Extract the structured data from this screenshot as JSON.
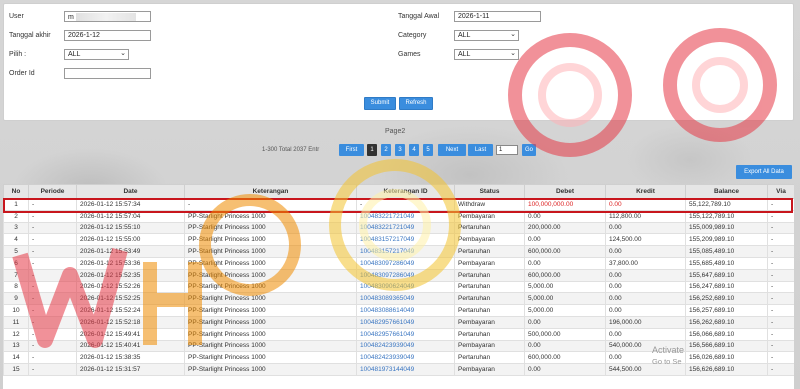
{
  "filters": {
    "user_label": "User",
    "user_value": "m",
    "tanggal_akhir_label": "Tanggal akhir",
    "tanggal_akhir_value": "2026-1-12",
    "pilih_label": "Pilih :",
    "pilih_value": "ALL",
    "order_id_label": "Order Id",
    "order_id_value": "",
    "tanggal_awal_label": "Tanggal Awal",
    "tanggal_awal_value": "2026-1-11",
    "category_label": "Category",
    "category_value": "ALL",
    "games_label": "Games",
    "games_value": "ALL",
    "submit_label": "Submit",
    "refresh_label": "Refresh"
  },
  "pager": {
    "title": "Page2",
    "entries": "1-300 Total 2037 Entr",
    "first": "First",
    "pages": [
      "1",
      "2",
      "3",
      "4",
      "5"
    ],
    "active_page": "1",
    "next": "Next",
    "last": "Last",
    "page_input": "1",
    "go": "Go"
  },
  "export_label": "Export All Data",
  "table": {
    "headers": [
      "No",
      "Periode",
      "Date",
      "Keterangan",
      "Keterangan ID",
      "Status",
      "Debet",
      "Kredit",
      "Balance",
      "Via"
    ],
    "rows": [
      [
        "1",
        "-",
        "2026-01-12 15:57:34",
        "-",
        "-",
        "Withdraw",
        "100,000,000.00",
        "0.00",
        "55,122,789.10",
        "-"
      ],
      [
        "2",
        "-",
        "2026-01-12 15:57:04",
        "PP-Starlight Princess 1000",
        "100483221721049",
        "Pembayaran",
        "0.00",
        "112,800.00",
        "155,122,789.10",
        "-"
      ],
      [
        "3",
        "-",
        "2026-01-12 15:55:10",
        "PP-Starlight Princess 1000",
        "100483221721049",
        "Pertaruhan",
        "200,000.00",
        "0.00",
        "155,009,989.10",
        "-"
      ],
      [
        "4",
        "-",
        "2026-01-12 15:55:00",
        "PP-Starlight Princess 1000",
        "100483157217049",
        "Pembayaran",
        "0.00",
        "124,500.00",
        "155,209,989.10",
        "-"
      ],
      [
        "5",
        "-",
        "2026-01-12 15:53:49",
        "PP-Starlight Princess 1000",
        "100483157217049",
        "Pertaruhan",
        "600,000.00",
        "0.00",
        "155,085,489.10",
        "-"
      ],
      [
        "6",
        "-",
        "2026-01-12 15:53:36",
        "PP-Starlight Princess 1000",
        "100483097286049",
        "Pembayaran",
        "0.00",
        "37,800.00",
        "155,685,489.10",
        "-"
      ],
      [
        "7",
        "-",
        "2026-01-12 15:52:35",
        "PP-Starlight Princess 1000",
        "100483097286049",
        "Pertaruhan",
        "600,000.00",
        "0.00",
        "155,647,689.10",
        "-"
      ],
      [
        "8",
        "-",
        "2026-01-12 15:52:26",
        "PP-Starlight Princess 1000",
        "100483090624049",
        "Pertaruhan",
        "5,000.00",
        "0.00",
        "156,247,689.10",
        "-"
      ],
      [
        "9",
        "-",
        "2026-01-12 15:52:25",
        "PP-Starlight Princess 1000",
        "100483089365049",
        "Pertaruhan",
        "5,000.00",
        "0.00",
        "156,252,689.10",
        "-"
      ],
      [
        "10",
        "-",
        "2026-01-12 15:52:24",
        "PP-Starlight Princess 1000",
        "100483088614049",
        "Pertaruhan",
        "5,000.00",
        "0.00",
        "156,257,689.10",
        "-"
      ],
      [
        "11",
        "-",
        "2026-01-12 15:52:18",
        "PP-Starlight Princess 1000",
        "100482957661049",
        "Pembayaran",
        "0.00",
        "196,000.00",
        "156,262,689.10",
        "-"
      ],
      [
        "12",
        "-",
        "2026-01-12 15:49:41",
        "PP-Starlight Princess 1000",
        "100482957661049",
        "Pertaruhan",
        "500,000.00",
        "0.00",
        "156,066,689.10",
        "-"
      ],
      [
        "13",
        "-",
        "2026-01-12 15:40:41",
        "PP-Starlight Princess 1000",
        "100482423939049",
        "Pembayaran",
        "0.00",
        "540,000.00",
        "156,566,689.10",
        "-"
      ],
      [
        "14",
        "-",
        "2026-01-12 15:38:35",
        "PP-Starlight Princess 1000",
        "100482423939049",
        "Pertaruhan",
        "600,000.00",
        "0.00",
        "156,026,689.10",
        "-"
      ],
      [
        "15",
        "-",
        "2026-01-12 15:31:57",
        "PP-Starlight Princess 1000",
        "100481973144049",
        "Pembayaran",
        "0.00",
        "544,500.00",
        "156,626,689.10",
        "-"
      ]
    ]
  },
  "windows_notice": {
    "line1": "Activate",
    "line2": "Go to Se"
  },
  "colors": {
    "accent": "#3a8dde",
    "highlight_border": "#c8161d",
    "link": "#3a76c2"
  }
}
